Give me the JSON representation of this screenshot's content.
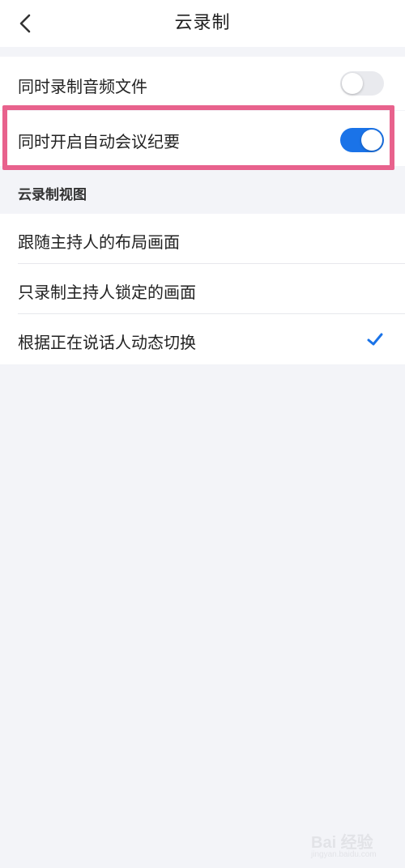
{
  "header": {
    "title": "云录制",
    "back_icon": "chevron-left-icon"
  },
  "settings": {
    "audio_file": {
      "label": "同时录制音频文件",
      "enabled": false
    },
    "auto_minutes": {
      "label": "同时开启自动会议纪要",
      "enabled": true
    }
  },
  "view_section": {
    "title": "云录制视图",
    "options": [
      {
        "label": "跟随主持人的布局画面",
        "selected": false
      },
      {
        "label": "只录制主持人锁定的画面",
        "selected": false
      },
      {
        "label": "根据正在说话人动态切换",
        "selected": true
      }
    ]
  },
  "watermark": {
    "text": "Bai 经验",
    "url": "jingyan.baidu.com"
  },
  "colors": {
    "accent": "#1a73e8",
    "highlight_border": "#e8628d",
    "background": "#f3f4f8"
  }
}
